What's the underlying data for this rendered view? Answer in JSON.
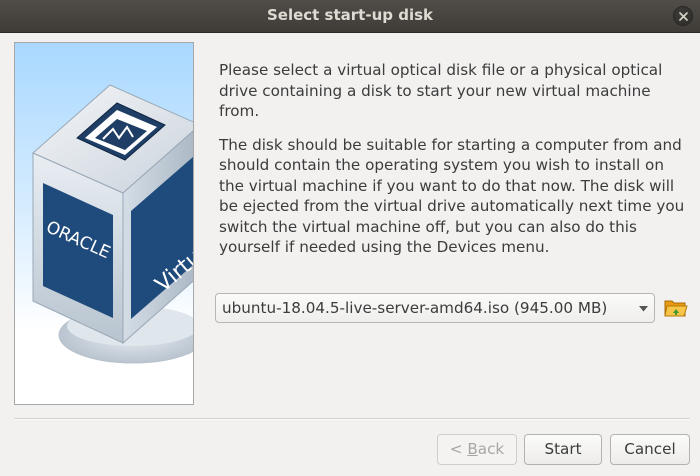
{
  "window": {
    "title": "Select start-up disk"
  },
  "instructions": {
    "paragraph1": "Please select a virtual optical disk file or a physical optical drive containing a disk to start your new virtual machine from.",
    "paragraph2": "The disk should be suitable for starting a computer from and should contain the operating system you wish to install on the virtual machine if you want to do that now. The disk will be ejected from the virtual drive automatically next time you switch the virtual machine off, but you can also do this yourself if needed using the Devices menu."
  },
  "disk_selector": {
    "selected": "ubuntu-18.04.5-live-server-amd64.iso (945.00 MB)",
    "browse_icon": "folder-icon"
  },
  "logo": {
    "brand_text": "ORACLE",
    "product_text_partial": "Virtu"
  },
  "buttons": {
    "back_prefix": "< ",
    "back_mnemonic": "B",
    "back_rest": "ack",
    "start": "Start",
    "cancel": "Cancel"
  },
  "colors": {
    "titlebar": "#45423e",
    "cube_blue": "#1f5a99",
    "accent_folder": "#f2a81d"
  }
}
